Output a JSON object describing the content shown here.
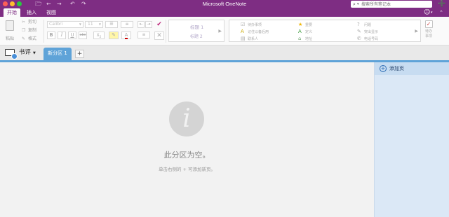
{
  "window": {
    "title": "Microsoft OneNote",
    "search_placeholder": "搜索所有笔记本"
  },
  "ribbon_tabs": [
    {
      "label": "开始",
      "active": true
    },
    {
      "label": "插入",
      "active": false
    },
    {
      "label": "视图",
      "active": false
    }
  ],
  "clipboard": {
    "paste_label": "粘贴",
    "cut_label": "剪切",
    "copy_label": "复制",
    "format_label": "格式"
  },
  "font": {
    "name": "Calibri",
    "size": "11"
  },
  "styles": {
    "heading1": "标题 1",
    "heading2": "标题 2"
  },
  "tags": {
    "todo": "待办事项",
    "important": "重要",
    "question": "问题",
    "remember": "记住以备后用",
    "definition": "定义",
    "highlight": "突出显示",
    "contact": "联系人",
    "address": "地址",
    "phone": "电话号码"
  },
  "todo_button": {
    "line1": "待办",
    "line2": "事项"
  },
  "notebook": {
    "name": "书评",
    "section_tab": "新分区 1"
  },
  "canvas": {
    "empty_title": "此分区为空。",
    "empty_hint": "单击右侧的 + 可添加新页。"
  },
  "pages_pane": {
    "add_page": "添加页"
  },
  "colors": {
    "brand": "#7e2d83",
    "section_blue": "#5fa3d8",
    "pages_pane": "#dbe8f6"
  }
}
